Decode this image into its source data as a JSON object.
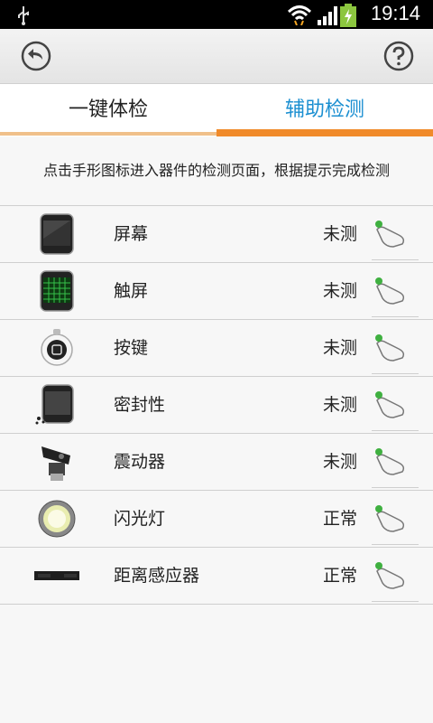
{
  "status_bar": {
    "time": "19:14",
    "icons": [
      "usb-icon",
      "wifi-icon",
      "signal-icon",
      "battery-charging-icon"
    ]
  },
  "toolbar": {
    "back_icon": "back-arrow-icon",
    "help_icon": "help-icon"
  },
  "tabs": [
    {
      "label": "一键体检",
      "active": false
    },
    {
      "label": "辅助检测",
      "active": true
    }
  ],
  "colors": {
    "accent_orange": "#f08a2a",
    "active_tab_text": "#1b8fd1",
    "status_bar_bg": "#000000"
  },
  "instruction": "点击手形图标进入器件的检测页面，根据提示完成检测",
  "items": [
    {
      "name": "屏幕",
      "status": "未测",
      "icon": "phone-screen-icon"
    },
    {
      "name": "触屏",
      "status": "未测",
      "icon": "touchscreen-icon"
    },
    {
      "name": "按键",
      "status": "未测",
      "icon": "home-button-icon"
    },
    {
      "name": "密封性",
      "status": "未测",
      "icon": "water-seal-icon"
    },
    {
      "name": "震动器",
      "status": "未测",
      "icon": "vibrator-icon"
    },
    {
      "name": "闪光灯",
      "status": "正常",
      "icon": "flashlight-icon"
    },
    {
      "name": "距离感应器",
      "status": "正常",
      "icon": "proximity-sensor-icon"
    }
  ]
}
